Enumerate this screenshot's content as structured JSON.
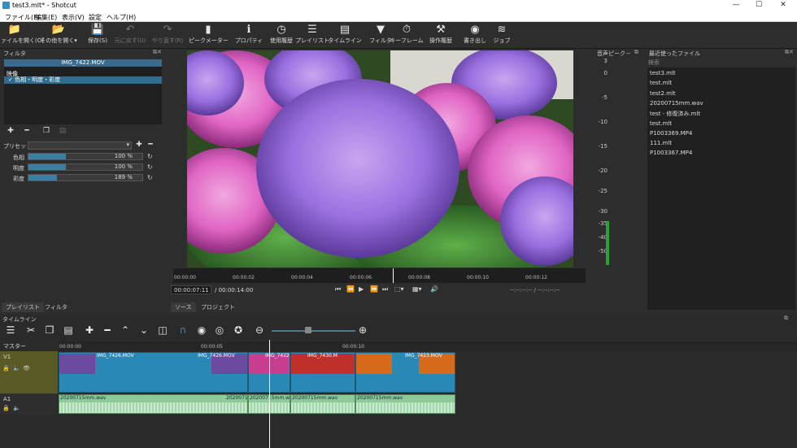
{
  "window": {
    "title": "test3.mlt* - Shotcut",
    "min": "—",
    "max": "☐",
    "close": "✕"
  },
  "menu": [
    "ファイル(F)",
    "編集(E)",
    "表示(V)",
    "設定",
    "ヘルプ(H)"
  ],
  "toolbar": [
    {
      "label": "ファイルを開く(O)",
      "icon": "folder-open-icon",
      "glyph": "📁",
      "dim": false
    },
    {
      "label": "その他を開く▾",
      "icon": "open-other-icon",
      "glyph": "📂",
      "dim": false
    },
    {
      "label": "保存(S)",
      "icon": "save-icon",
      "glyph": "💾",
      "dim": false
    },
    {
      "label": "元に戻す(U)",
      "icon": "undo-icon",
      "glyph": "↶",
      "dim": true
    },
    {
      "label": "やり直す(R)",
      "icon": "redo-icon",
      "glyph": "↷",
      "dim": true
    },
    {
      "label": "ピークメーター",
      "icon": "peak-meter-icon",
      "glyph": "▮",
      "dim": false
    },
    {
      "label": "プロパティ",
      "icon": "properties-icon",
      "glyph": "ℹ",
      "dim": false
    },
    {
      "label": "使用履歴",
      "icon": "history-icon",
      "glyph": "◷",
      "dim": false
    },
    {
      "label": "プレイリスト",
      "icon": "playlist-icon",
      "glyph": "☰",
      "dim": false
    },
    {
      "label": "タイムライン",
      "icon": "timeline-icon",
      "glyph": "▤",
      "dim": false
    },
    {
      "label": "フィルタ",
      "icon": "filter-icon",
      "glyph": "▼",
      "dim": false
    },
    {
      "label": "キーフレーム",
      "icon": "keyframe-icon",
      "glyph": "⏱",
      "dim": false
    },
    {
      "label": "操作履歴",
      "icon": "undo-history-icon",
      "glyph": "⚒",
      "dim": false
    },
    {
      "label": "書き出し",
      "icon": "export-icon",
      "glyph": "◉",
      "dim": false
    },
    {
      "label": "ジョブ",
      "icon": "jobs-icon",
      "glyph": "≋",
      "dim": false
    }
  ],
  "filters_panel": {
    "title": "フィルタ",
    "clip": "IMG_7422.MOV",
    "section": "映像",
    "item": "✓ 色相・明度・彩度",
    "preset_label": "プリセット",
    "params": [
      {
        "label": "色相",
        "value": "100 %",
        "fraction": 0.33
      },
      {
        "label": "明度",
        "value": "100 %",
        "fraction": 0.33
      },
      {
        "label": "彩度",
        "value": "189 %",
        "fraction": 0.25
      }
    ]
  },
  "player": {
    "ticks": [
      "00:00:00",
      "00:00:02",
      "00:00:04",
      "00:00:06",
      "00:00:08",
      "00:00:10",
      "00:00:12"
    ],
    "position": "00:00:07:11",
    "duration": "/ 00:00:14:00",
    "in_out": "--:--:--:-- /  --:--:--:--"
  },
  "meter": {
    "title": "音声ピーク－",
    "ticks": [
      "3",
      "0",
      "-5",
      "-10",
      "-15",
      "-20",
      "-25",
      "-30",
      "-35",
      "-40",
      "-50"
    ]
  },
  "recent": {
    "title": "最近使ったファイル",
    "search": "検索",
    "items": [
      "test3.mlt",
      "test.mlt",
      "test2.mlt",
      "20200715mm.wav",
      "test - 修復済み.mlt",
      "test.mlt",
      "P1003369.MP4",
      "111.mlt",
      "P1003367.MP4"
    ]
  },
  "tabs": {
    "left": [
      "プレイリスト",
      "フィルタ"
    ],
    "mid": [
      "ソース",
      "プロジェクト"
    ]
  },
  "timeline": {
    "title": "タイムライン",
    "master": "マスター",
    "ruler": [
      "00:00:00",
      "00:00:05",
      "00:00:10"
    ],
    "v1": "V1",
    "a1": "A1",
    "vclips": [
      "IMG_7426.MOV",
      "IMG_7426.MOV",
      "IMG_7422.",
      "IMG_7430.M",
      "IMG_7423.MOV"
    ],
    "aclips": [
      "20200715mm.wav",
      "20200715mm.wav",
      "20200715mm.wav",
      "20200715mm.wav",
      "20200715mm.wav"
    ]
  }
}
